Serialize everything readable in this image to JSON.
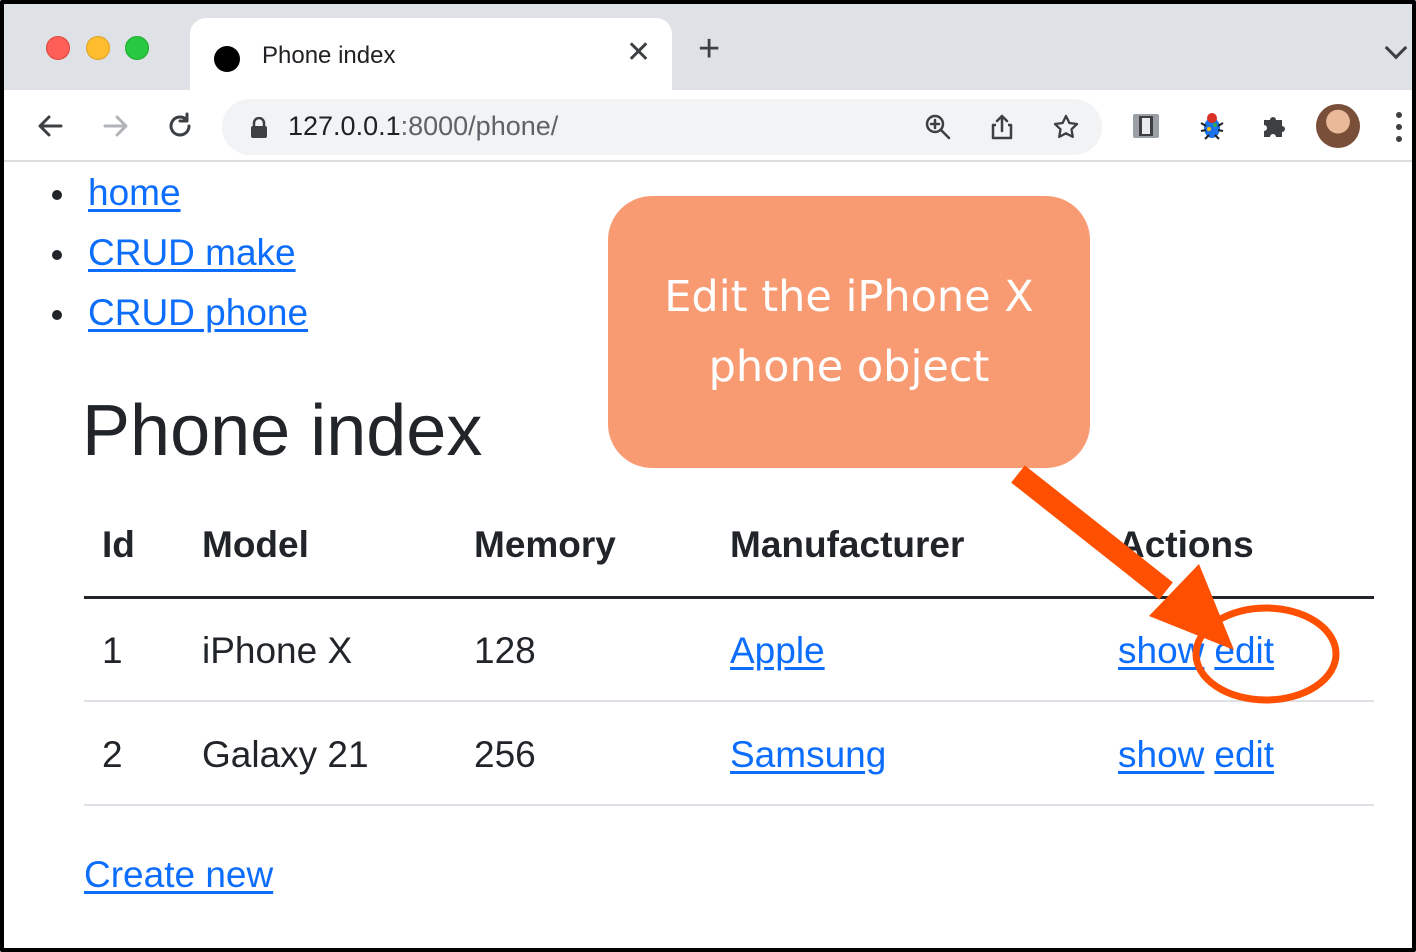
{
  "browser": {
    "tab_title": "Phone index",
    "tab_close_glyph": "✕",
    "new_tab_glyph": "+",
    "url_host": "127.0.0.1",
    "url_rest": ":8000/phone/"
  },
  "nav": {
    "items": [
      {
        "label": "home"
      },
      {
        "label": "CRUD make"
      },
      {
        "label": "CRUD phone"
      }
    ]
  },
  "page": {
    "title": "Phone index",
    "create_new": "Create new"
  },
  "table": {
    "headers": {
      "id": "Id",
      "model": "Model",
      "memory": "Memory",
      "manufacturer": "Manufacturer",
      "actions": "Actions"
    },
    "rows": [
      {
        "id": "1",
        "model": "iPhone X",
        "memory": "128",
        "manufacturer": "Apple",
        "show": "show",
        "edit": "edit"
      },
      {
        "id": "2",
        "model": "Galaxy 21",
        "memory": "256",
        "manufacturer": "Samsung",
        "show": "show",
        "edit": "edit"
      }
    ]
  },
  "annotation": {
    "callout_line1": "Edit the iPhone X",
    "callout_line2": "phone object",
    "color": "#f89b73",
    "arrow_color": "#ff4f00"
  }
}
